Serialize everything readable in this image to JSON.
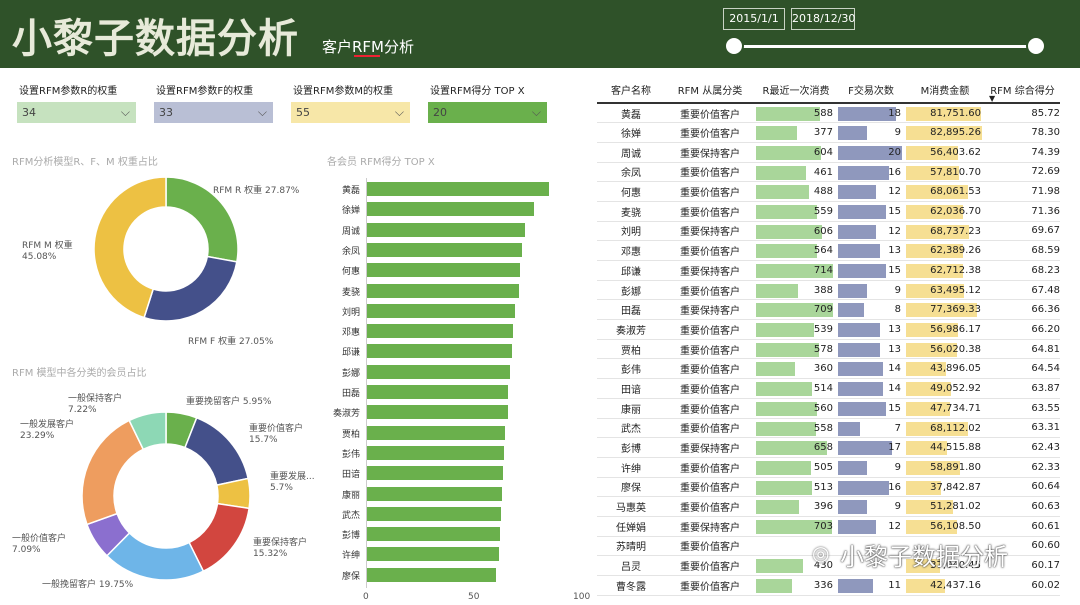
{
  "header": {
    "title": "小黎子数据分析",
    "subtitle": "客户RFM分析",
    "date_start": "2015/1/1",
    "date_end": "2018/12/30"
  },
  "controls": [
    {
      "label": "设置RFM参数R的权重",
      "value": "34",
      "color": "#c6e2bf"
    },
    {
      "label": "设置RFM参数F的权重",
      "value": "33",
      "color": "#b9bfd5"
    },
    {
      "label": "设置RFM参数M的权重",
      "value": "55",
      "color": "#f7e7a8"
    },
    {
      "label": "设置RFM得分 TOP X",
      "value": "20",
      "color": "#6ab04c"
    }
  ],
  "weights_chart": {
    "title": "RFM分析模型R、F、M 权重占比",
    "slices": [
      {
        "name": "RFM R 权重",
        "pct": "27.87%",
        "value": 27.87,
        "color": "#6ab04c"
      },
      {
        "name": "RFM F 权重",
        "pct": "27.05%",
        "value": 27.05,
        "color": "#44508a"
      },
      {
        "name": "RFM M 权重",
        "pct": "45.08%",
        "value": 45.08,
        "color": "#edc143"
      }
    ]
  },
  "segment_chart": {
    "title": "RFM 模型中各分类的会员占比",
    "slices": [
      {
        "name": "重要挽留客户",
        "pct": "5.95%",
        "value": 5.95,
        "color": "#6ab04c"
      },
      {
        "name": "重要价值客户",
        "pct": "15.7%",
        "value": 15.7,
        "color": "#44508a"
      },
      {
        "name": "重要发展...",
        "pct": "5.7%",
        "value": 5.7,
        "color": "#edc143"
      },
      {
        "name": "重要保持客户",
        "pct": "15.32%",
        "value": 15.32,
        "color": "#d2463f"
      },
      {
        "name": "一般挽留客户",
        "pct": "19.75%",
        "value": 19.75,
        "color": "#6eb5e8"
      },
      {
        "name": "一般价值客户",
        "pct": "7.09%",
        "value": 7.09,
        "color": "#8b6fcf"
      },
      {
        "name": "一般发展客户",
        "pct": "23.29%",
        "value": 23.29,
        "color": "#ee9d5f"
      },
      {
        "name": "一般保持客户",
        "pct": "7.22%",
        "value": 7.22,
        "color": "#8dd8b5"
      }
    ]
  },
  "chart_data": {
    "type": "bar",
    "title": "各会员 RFM得分 TOP X",
    "categories": [
      "黄磊",
      "徐婵",
      "周诚",
      "余凤",
      "何惠",
      "麦骁",
      "刘明",
      "邓惠",
      "邱谦",
      "彭娜",
      "田磊",
      "奏淑芳",
      "贾柏",
      "彭伟",
      "田谙",
      "康丽",
      "武杰",
      "彭博",
      "许绅",
      "廖保"
    ],
    "values": [
      85.72,
      78.3,
      74.39,
      72.69,
      71.98,
      71.36,
      69.67,
      68.59,
      68.23,
      67.48,
      66.36,
      66.2,
      64.81,
      64.54,
      63.87,
      63.55,
      63.31,
      62.43,
      62.33,
      60.64
    ],
    "xlim": [
      0,
      100
    ],
    "xticks": [
      "0",
      "50",
      "100"
    ]
  },
  "table": {
    "headers": [
      "客户名称",
      "RFM 从属分类",
      "R最近一次消费",
      "F交易次数",
      "M消费金额",
      "RFM 综合得分"
    ],
    "sort_indicator": "▼",
    "r_max": 720,
    "f_max": 20,
    "m_max": 82895.26,
    "rows": [
      {
        "name": "黄磊",
        "seg": "重要价值客户",
        "r": "588",
        "f": "18",
        "m": "81,751.60",
        "s": "85.72"
      },
      {
        "name": "徐婵",
        "seg": "重要价值客户",
        "r": "377",
        "f": "9",
        "m": "82,895.26",
        "s": "78.30"
      },
      {
        "name": "周诚",
        "seg": "重要保持客户",
        "r": "604",
        "f": "20",
        "m": "56,403.62",
        "s": "74.39"
      },
      {
        "name": "余凤",
        "seg": "重要价值客户",
        "r": "461",
        "f": "16",
        "m": "57,810.70",
        "s": "72.69"
      },
      {
        "name": "何惠",
        "seg": "重要价值客户",
        "r": "488",
        "f": "12",
        "m": "68,061.53",
        "s": "71.98"
      },
      {
        "name": "麦骁",
        "seg": "重要价值客户",
        "r": "559",
        "f": "15",
        "m": "62,036.70",
        "s": "71.36"
      },
      {
        "name": "刘明",
        "seg": "重要保持客户",
        "r": "606",
        "f": "12",
        "m": "68,737.23",
        "s": "69.67"
      },
      {
        "name": "邓惠",
        "seg": "重要价值客户",
        "r": "564",
        "f": "13",
        "m": "62,389.26",
        "s": "68.59"
      },
      {
        "name": "邱谦",
        "seg": "重要保持客户",
        "r": "714",
        "f": "15",
        "m": "62,712.38",
        "s": "68.23"
      },
      {
        "name": "彭娜",
        "seg": "重要价值客户",
        "r": "388",
        "f": "9",
        "m": "63,495.12",
        "s": "67.48"
      },
      {
        "name": "田磊",
        "seg": "重要保持客户",
        "r": "709",
        "f": "8",
        "m": "77,369.33",
        "s": "66.36"
      },
      {
        "name": "奏淑芳",
        "seg": "重要价值客户",
        "r": "539",
        "f": "13",
        "m": "56,986.17",
        "s": "66.20"
      },
      {
        "name": "贾柏",
        "seg": "重要价值客户",
        "r": "578",
        "f": "13",
        "m": "56,020.38",
        "s": "64.81"
      },
      {
        "name": "彭伟",
        "seg": "重要价值客户",
        "r": "360",
        "f": "14",
        "m": "43,896.05",
        "s": "64.54"
      },
      {
        "name": "田谙",
        "seg": "重要价值客户",
        "r": "514",
        "f": "14",
        "m": "49,052.92",
        "s": "63.87"
      },
      {
        "name": "康丽",
        "seg": "重要价值客户",
        "r": "560",
        "f": "15",
        "m": "47,734.71",
        "s": "63.55"
      },
      {
        "name": "武杰",
        "seg": "重要价值客户",
        "r": "558",
        "f": "7",
        "m": "68,112.02",
        "s": "63.31"
      },
      {
        "name": "彭博",
        "seg": "重要保持客户",
        "r": "658",
        "f": "17",
        "m": "44,515.88",
        "s": "62.43"
      },
      {
        "name": "许绅",
        "seg": "重要价值客户",
        "r": "505",
        "f": "9",
        "m": "58,891.80",
        "s": "62.33"
      },
      {
        "name": "廖保",
        "seg": "重要价值客户",
        "r": "513",
        "f": "16",
        "m": "37,842.87",
        "s": "60.64"
      },
      {
        "name": "马惠英",
        "seg": "重要价值客户",
        "r": "396",
        "f": "9",
        "m": "51,281.02",
        "s": "60.63"
      },
      {
        "name": "任婵娟",
        "seg": "重要保持客户",
        "r": "703",
        "f": "12",
        "m": "56,108.50",
        "s": "60.61"
      },
      {
        "name": "苏晴明",
        "seg": "重要价值客户",
        "r": "",
        "f": "",
        "m": "",
        "s": "60.60"
      },
      {
        "name": "吕灵",
        "seg": "重要价值客户",
        "r": "430",
        "f": "",
        "m": "37,040.45",
        "s": "60.17"
      },
      {
        "name": "曹冬露",
        "seg": "重要价值客户",
        "r": "336",
        "f": "11",
        "m": "42,437.16",
        "s": "60.02"
      }
    ]
  },
  "watermark": {
    "icon": "wechat-icon",
    "text": "小黎子数据分析"
  }
}
